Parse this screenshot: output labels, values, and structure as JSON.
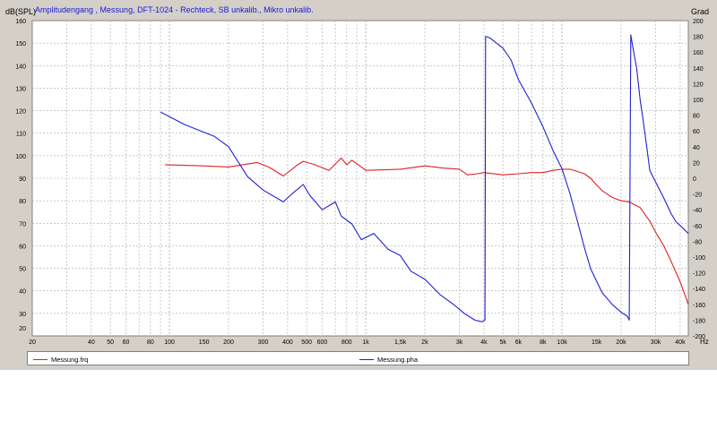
{
  "chart_data": {
    "type": "line",
    "title": "Amplitudengang , Messung, DFT-1024 - Rechteck, SB unkalib., Mikro unkalib.",
    "ylabel_left": "dB(SPL)",
    "ylabel_right": "Grad",
    "xlabel": "Hz",
    "x_scale": "log",
    "xlim": [
      20,
      44000
    ],
    "ylim_left": [
      20,
      160
    ],
    "ylim_right": [
      -200,
      200
    ],
    "grid": true,
    "y_ticks_left": [
      20,
      30,
      40,
      50,
      60,
      70,
      80,
      90,
      100,
      110,
      120,
      130,
      140,
      150,
      160
    ],
    "y_ticks_right": [
      -200,
      -180,
      -160,
      -140,
      -120,
      -100,
      -80,
      -60,
      -40,
      -20,
      0,
      20,
      40,
      60,
      80,
      100,
      120,
      140,
      160,
      180,
      200
    ],
    "x_ticks": [
      {
        "v": 20,
        "label": "20"
      },
      {
        "v": 40,
        "label": "40"
      },
      {
        "v": 50,
        "label": "50"
      },
      {
        "v": 60,
        "label": "60"
      },
      {
        "v": 80,
        "label": "80"
      },
      {
        "v": 100,
        "label": "100"
      },
      {
        "v": 150,
        "label": "150"
      },
      {
        "v": 200,
        "label": "200"
      },
      {
        "v": 300,
        "label": "300"
      },
      {
        "v": 400,
        "label": "400"
      },
      {
        "v": 500,
        "label": "500"
      },
      {
        "v": 600,
        "label": "600"
      },
      {
        "v": 800,
        "label": "800"
      },
      {
        "v": 1000,
        "label": "1k"
      },
      {
        "v": 1500,
        "label": "1,5k"
      },
      {
        "v": 2000,
        "label": "2k"
      },
      {
        "v": 3000,
        "label": "3k"
      },
      {
        "v": 4000,
        "label": "4k"
      },
      {
        "v": 5000,
        "label": "5k"
      },
      {
        "v": 6000,
        "label": "6k"
      },
      {
        "v": 8000,
        "label": "8k"
      },
      {
        "v": 10000,
        "label": "10k"
      },
      {
        "v": 15000,
        "label": "15k"
      },
      {
        "v": 20000,
        "label": "20k"
      },
      {
        "v": 30000,
        "label": "30k"
      },
      {
        "v": 40000,
        "label": "40k"
      }
    ],
    "series": [
      {
        "name": "Messung.frq",
        "axis": "left",
        "color": "#e02020",
        "points": [
          [
            95,
            96
          ],
          [
            150,
            95.5
          ],
          [
            200,
            95
          ],
          [
            280,
            97
          ],
          [
            320,
            95
          ],
          [
            380,
            91
          ],
          [
            450,
            96
          ],
          [
            480,
            97.5
          ],
          [
            550,
            96
          ],
          [
            650,
            93.5
          ],
          [
            750,
            99
          ],
          [
            800,
            96
          ],
          [
            850,
            98
          ],
          [
            950,
            95
          ],
          [
            1000,
            93.5
          ],
          [
            1500,
            94
          ],
          [
            2000,
            95.5
          ],
          [
            2500,
            94.5
          ],
          [
            3000,
            94
          ],
          [
            3300,
            91.5
          ],
          [
            3700,
            92
          ],
          [
            4000,
            92.5
          ],
          [
            5000,
            91.5
          ],
          [
            6000,
            92
          ],
          [
            7000,
            92.5
          ],
          [
            8000,
            92.5
          ],
          [
            9000,
            93.5
          ],
          [
            10000,
            94
          ],
          [
            11000,
            94
          ],
          [
            12000,
            93
          ],
          [
            13000,
            92
          ],
          [
            14000,
            90
          ],
          [
            15000,
            87
          ],
          [
            16000,
            84.5
          ],
          [
            18000,
            81.5
          ],
          [
            20000,
            80
          ],
          [
            22000,
            79.5
          ],
          [
            25000,
            77
          ],
          [
            28000,
            71
          ],
          [
            30000,
            66
          ],
          [
            33000,
            60
          ],
          [
            36000,
            53
          ],
          [
            40000,
            44
          ],
          [
            44000,
            34
          ]
        ]
      },
      {
        "name": "Messung.pha",
        "axis": "right",
        "color": "#2020d0",
        "points": [
          [
            90,
            84
          ],
          [
            120,
            68
          ],
          [
            170,
            53
          ],
          [
            200,
            40
          ],
          [
            250,
            2
          ],
          [
            300,
            -15
          ],
          [
            380,
            -30
          ],
          [
            420,
            -20
          ],
          [
            480,
            -8
          ],
          [
            520,
            -22
          ],
          [
            600,
            -40
          ],
          [
            700,
            -30
          ],
          [
            750,
            -48
          ],
          [
            850,
            -58
          ],
          [
            950,
            -78
          ],
          [
            1100,
            -70
          ],
          [
            1300,
            -90
          ],
          [
            1500,
            -98
          ],
          [
            1700,
            -118
          ],
          [
            2000,
            -128
          ],
          [
            2400,
            -148
          ],
          [
            2800,
            -160
          ],
          [
            3200,
            -172
          ],
          [
            3600,
            -180
          ],
          [
            3900,
            -182
          ],
          [
            4050,
            -180
          ],
          [
            4080,
            180
          ],
          [
            4300,
            178
          ],
          [
            5000,
            165
          ],
          [
            5500,
            150
          ],
          [
            6000,
            125
          ],
          [
            7000,
            95
          ],
          [
            8000,
            65
          ],
          [
            9000,
            35
          ],
          [
            10000,
            12
          ],
          [
            11000,
            -20
          ],
          [
            12000,
            -55
          ],
          [
            13000,
            -88
          ],
          [
            14000,
            -115
          ],
          [
            16000,
            -145
          ],
          [
            18000,
            -160
          ],
          [
            20000,
            -170
          ],
          [
            21500,
            -175
          ],
          [
            22000,
            -180
          ],
          [
            22400,
            182
          ],
          [
            23000,
            165
          ],
          [
            24000,
            140
          ],
          [
            25000,
            100
          ],
          [
            26000,
            70
          ],
          [
            27000,
            40
          ],
          [
            28000,
            10
          ],
          [
            30000,
            -5
          ],
          [
            33000,
            -25
          ],
          [
            36000,
            -45
          ],
          [
            38000,
            -55
          ],
          [
            40000,
            -60
          ],
          [
            44000,
            -70
          ]
        ]
      }
    ],
    "legend": "bottom"
  }
}
